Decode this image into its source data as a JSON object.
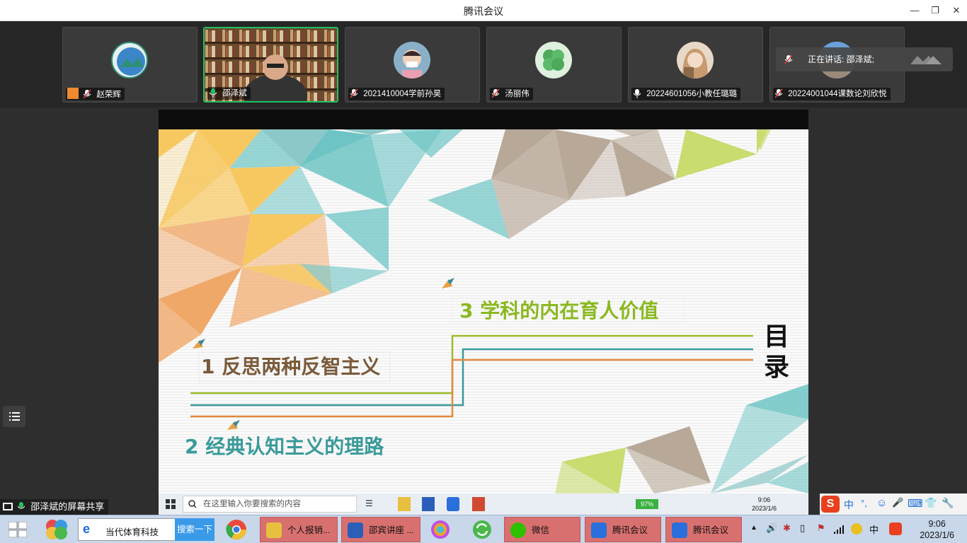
{
  "window": {
    "title": "腾讯会议",
    "minimize": "—",
    "restore": "❐",
    "close": "✕"
  },
  "participants": [
    {
      "name": "赵荣辉",
      "avatar_color": "#2f8f7a",
      "muted": true,
      "active": false
    },
    {
      "name": "邵泽斌",
      "avatar_color": "#6b4a2f",
      "muted": false,
      "active": true
    },
    {
      "name": "2021410004学前孙昊",
      "avatar_color": "#8ab0c8",
      "muted": true,
      "active": false
    },
    {
      "name": "汤丽伟",
      "avatar_color": "#4caa5a",
      "muted": true,
      "active": false
    },
    {
      "name": "20224601056小教任璐璐",
      "avatar_color": "#d8b59a",
      "muted": false,
      "active": false
    },
    {
      "name": "20224001044课数论刘欣悦",
      "avatar_color": "#7aa8d8",
      "muted": true,
      "active": false
    }
  ],
  "speaking": {
    "label": "正在讲话: 邵泽斌;"
  },
  "slide": {
    "heading": "目录",
    "items": [
      {
        "text": "1 反思两种反智主义",
        "color": "#7a5a3a"
      },
      {
        "text": "2  经典认知主义的理路",
        "color": "#3a9a9a"
      },
      {
        "text": "3  学科的内在育人价值",
        "color": "#8ab820"
      }
    ],
    "colors": {
      "orange": "#f0a868",
      "yellow": "#f8c860",
      "teal": "#6ec4c4",
      "tan": "#b8a898",
      "green": "#c8dc70"
    }
  },
  "share_label": "邵泽斌的屏幕共享",
  "inner_taskbar": {
    "search_placeholder": "在这里输入你要搜索的内容",
    "battery": "97%",
    "time": "9:06",
    "date": "2023/1/6"
  },
  "ime": {
    "items": [
      "中",
      "°,",
      "☺",
      "🎤",
      "⌨",
      "👕",
      "🔧"
    ]
  },
  "taskbar": {
    "ie_text": "当代体育科技",
    "search_btn": "搜索一下",
    "windows": [
      {
        "label": "个人报销...",
        "icon_color": "#e8c040"
      },
      {
        "label": "邵宾讲座 ...",
        "icon_color": "#2b5eb8"
      },
      {
        "label": "微信",
        "icon_color": "#2dc100"
      },
      {
        "label": "腾讯会议",
        "icon_color": "#2a6fdb"
      },
      {
        "label": "腾讯会议",
        "icon_color": "#2a6fdb"
      }
    ],
    "tray_lang": "中",
    "time": "9:06",
    "date": "2023/1/6"
  }
}
